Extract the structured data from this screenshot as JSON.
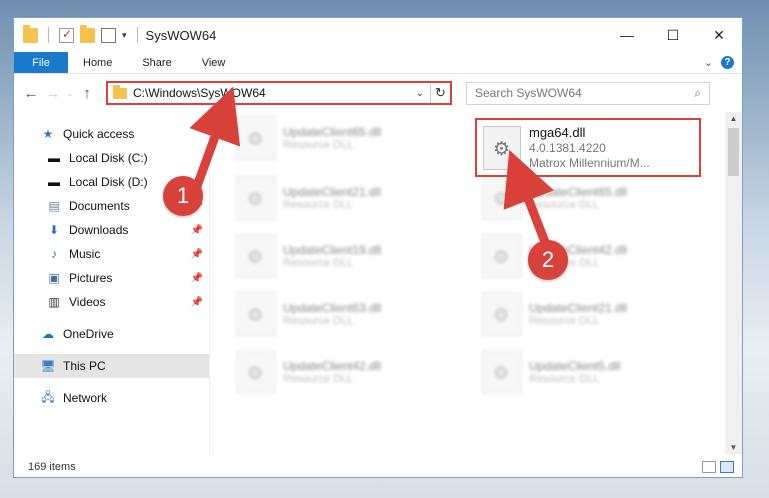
{
  "window": {
    "title": "SysWOW64",
    "controls": {
      "minimize": "—",
      "maximize": "☐",
      "close": "✕"
    }
  },
  "ribbon": {
    "tabs": [
      "File",
      "Home",
      "Share",
      "View"
    ],
    "expand_icon": "chevron-down-icon",
    "help_label": "?"
  },
  "address": {
    "path": "C:\\Windows\\SysWOW64",
    "search_placeholder": "Search SysWOW64"
  },
  "sidebar": {
    "quick_access": "Quick access",
    "items": [
      {
        "label": "Local Disk (C:)",
        "icon": "drive-icon",
        "pinned": false
      },
      {
        "label": "Local Disk (D:)",
        "icon": "drive-icon",
        "pinned": false
      },
      {
        "label": "Documents",
        "icon": "documents-icon",
        "pinned": true
      },
      {
        "label": "Downloads",
        "icon": "download-icon",
        "pinned": true
      },
      {
        "label": "Music",
        "icon": "music-icon",
        "pinned": true
      },
      {
        "label": "Pictures",
        "icon": "pictures-icon",
        "pinned": true
      },
      {
        "label": "Videos",
        "icon": "videos-icon",
        "pinned": true
      }
    ],
    "onedrive": "OneDrive",
    "this_pc": "This PC",
    "network": "Network"
  },
  "files_left": [
    {
      "name": "UpdateClient65.dll",
      "type": "Resource DLL"
    },
    {
      "name": "UpdateClient21.dll",
      "type": "Resource DLL"
    },
    {
      "name": "UpdateClient19.dll",
      "type": "Resource DLL"
    },
    {
      "name": "UpdateClient63.dll",
      "type": "Resource DLL"
    },
    {
      "name": "UpdateClient42.dll",
      "type": "Resource DLL"
    }
  ],
  "files_right": [
    {
      "name": "UpdateClient65.dll",
      "type": "Resource DLL"
    },
    {
      "name": "UpdateClient42.dll",
      "type": "Resource DLL"
    },
    {
      "name": "UpdateClient21.dll",
      "type": "Resource DLL"
    },
    {
      "name": "UpdateClient5.dll",
      "type": "Resource DLL"
    }
  ],
  "highlighted_file": {
    "name": "mga64.dll",
    "version": "4.0.1381.4220",
    "description": "Matrox Millennium/M..."
  },
  "annotations": {
    "step1": "1",
    "step2": "2",
    "color": "#d9423a"
  },
  "status": {
    "count": "169 items"
  }
}
